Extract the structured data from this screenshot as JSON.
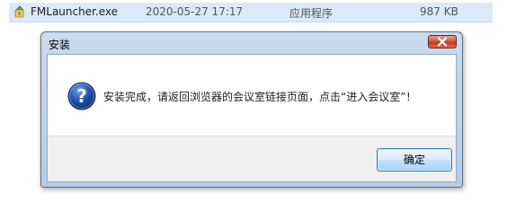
{
  "file_row": {
    "icon": "installer-icon",
    "name": "FMLauncher.exe",
    "date": "2020-05-27 17:17",
    "type": "应用程序",
    "size": "987 KB"
  },
  "dialog": {
    "title": "安装",
    "close_icon": "close-icon",
    "icon": "question-icon",
    "message": "安装完成，请返回浏览器的会议室链接页面，点击“进入会议室”！",
    "ok_label": "确定"
  },
  "colors": {
    "selection": "#dce9f8",
    "titlebar": "#c8dcef",
    "close": "#c63b1f",
    "question": "#1b4fa6",
    "button_border": "#3c7fb1"
  }
}
